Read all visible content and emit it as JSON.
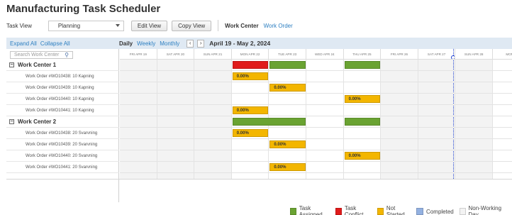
{
  "app": {
    "title": "Manufacturing Task Scheduler"
  },
  "toolbar": {
    "task_view_label": "Task View",
    "task_view_value": "Planning",
    "edit_view_label": "Edit View",
    "copy_view_label": "Copy View",
    "work_center_label": "Work Center",
    "work_order_label": "Work Order"
  },
  "left_header": {
    "expand_all": "Expand All",
    "collapse_all": "Collapse All"
  },
  "view_modes": {
    "daily": "Daily",
    "weekly": "Weekly",
    "monthly": "Monthly"
  },
  "range_label": "April 19 - May 2, 2024",
  "search": {
    "placeholder": "Search Work Center"
  },
  "days": [
    {
      "label": "FRI APR 19",
      "shaded": true
    },
    {
      "label": "SAT APR 20",
      "shaded": true
    },
    {
      "label": "SUN APR 21",
      "shaded": true
    },
    {
      "label": "MON APR 22",
      "shaded": false
    },
    {
      "label": "TUE APR 23",
      "shaded": false
    },
    {
      "label": "WED APR 24",
      "shaded": false
    },
    {
      "label": "THU APR 25",
      "shaded": false
    },
    {
      "label": "FRI APR 26",
      "shaded": true
    },
    {
      "label": "SAT APR 27",
      "shaded": true
    },
    {
      "label": "SUN APR 28",
      "shaded": true
    },
    {
      "label": "MON A",
      "shaded": false
    }
  ],
  "groups": [
    {
      "name": "Work Center 1",
      "summary": [
        {
          "day": 3,
          "status": "conflict"
        },
        {
          "day": 4,
          "status": "assigned"
        },
        {
          "day": 6,
          "status": "assigned"
        }
      ],
      "orders": [
        {
          "label": "Work Order #WO10438: 10 Kapning",
          "day": 3,
          "pct": "0.00%"
        },
        {
          "label": "Work Order #WO10439: 10 Kapning",
          "day": 4,
          "pct": "0.00%"
        },
        {
          "label": "Work Order #WO10440: 10 Kapning",
          "day": 6,
          "pct": "0.00%"
        },
        {
          "label": "Work Order #WO10441: 10 Kapning",
          "day": 3,
          "pct": "0.00%"
        }
      ]
    },
    {
      "name": "Work Center 2",
      "summary": [
        {
          "day": 3,
          "status": "assigned",
          "span": 2
        },
        {
          "day": 6,
          "status": "assigned"
        }
      ],
      "orders": [
        {
          "label": "Work Order #WO10438: 20 Svarvning",
          "day": 3,
          "pct": "0.00%"
        },
        {
          "label": "Work Order #WO10439: 20 Svarvning",
          "day": 4,
          "pct": "0.00%"
        },
        {
          "label": "Work Order #WO10440: 20 Svarvning",
          "day": 6,
          "pct": "0.00%"
        },
        {
          "label": "Work Order #WO10441: 20 Svarvning",
          "day": 4,
          "pct": "0.00%"
        }
      ]
    }
  ],
  "colors": {
    "assigned": "#6aa332",
    "conflict": "#e01b1b",
    "not_started": "#f3b600",
    "completed": "#93b1e1",
    "non_working": "#f3f3f3",
    "today_line": "#1d3fd0"
  },
  "legend": [
    {
      "label": "Task Assigned",
      "color": "#6aa332"
    },
    {
      "label": "Task Conflict",
      "color": "#e01b1b"
    },
    {
      "label": "Not Started",
      "color": "#f3b600"
    },
    {
      "label": "Completed",
      "color": "#93b1e1"
    },
    {
      "label": "Non-Working Day",
      "color": "#f3f3f3"
    }
  ]
}
